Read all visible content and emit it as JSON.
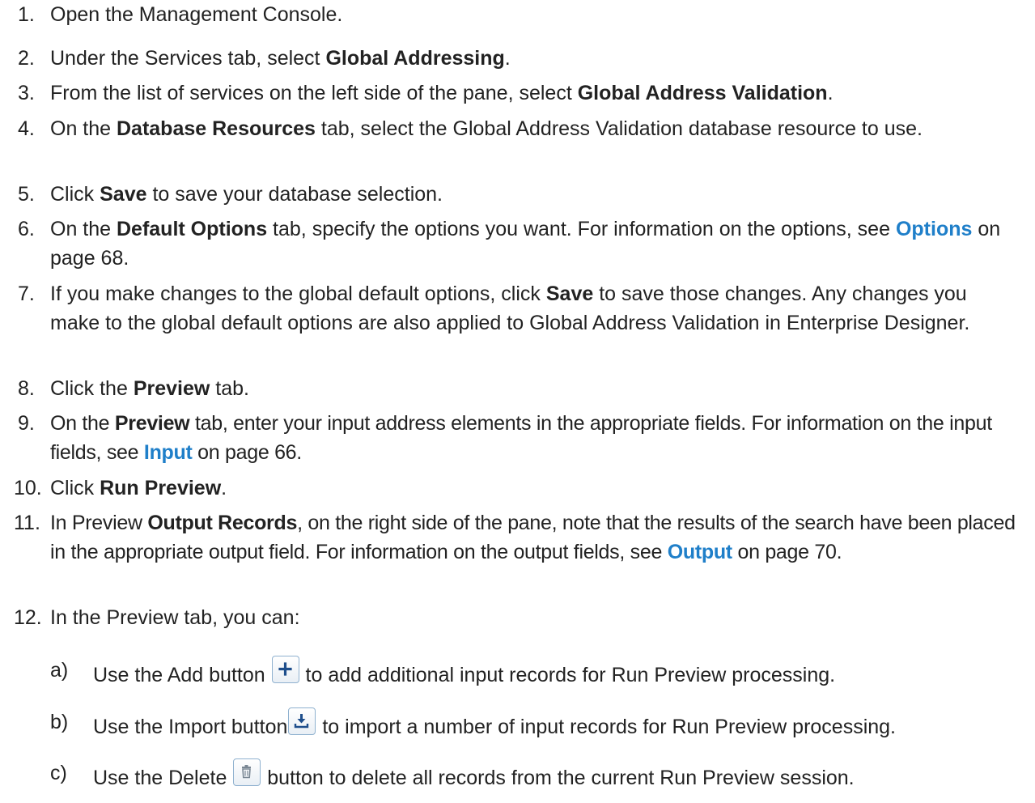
{
  "steps": [
    {
      "n": "1.",
      "parts": [
        "Open the Management Console."
      ]
    },
    {
      "n": "2.",
      "a": "Under the Services tab, select ",
      "b": "Global Addressing",
      "c": "."
    },
    {
      "n": "3.",
      "a": "From the list of services on the left side of the pane, select ",
      "b": "Global Address Validation",
      "c": "."
    },
    {
      "n": "4.",
      "a": "On the ",
      "b": "Database Resources",
      "c": " tab, select the Global Address Validation database resource to use."
    },
    {
      "n": "5.",
      "a": "Click ",
      "b": "Save",
      "c": " to save your database selection."
    },
    {
      "n": "6.",
      "a": "On the ",
      "b": "Default Options",
      "c": " tab, specify the options you want. For information on the options, see ",
      "link": "Options",
      "d": " on page 68."
    },
    {
      "n": "7.",
      "a": "If you make changes to the global default options, click ",
      "b": "Save",
      "c": " to save those changes. Any changes you make to the global default options are also applied to Global Address Validation in Enterprise Designer."
    },
    {
      "n": "8.",
      "a": "Click the ",
      "b": "Preview",
      "c": " tab."
    },
    {
      "n": "9.",
      "a": "On the ",
      "b": "Preview",
      "c": " tab, enter your input address elements in the appropriate fields. For information on the input fields, see ",
      "link": "Input",
      "d": " on page 66."
    },
    {
      "n": "10.",
      "a": "Click ",
      "b": "Run Preview",
      "c": "."
    },
    {
      "n": "11.",
      "a": "In Preview ",
      "b": "Output Records",
      "c": ", on the right side of the pane, note that the results of the search have been placed in the appropriate output field. For information on the output fields, see ",
      "link": "Output",
      "d": " on page 70."
    },
    {
      "n": "12.",
      "a": "In the Preview tab, you can:"
    }
  ],
  "substeps": [
    {
      "letter": "a)",
      "before": "Use the Add button ",
      "icon": "add-icon",
      "after": " to add additional input records for Run Preview processing."
    },
    {
      "letter": "b)",
      "before": "Use the Import button",
      "icon": "import-icon",
      "after": " to import a number of input records for Run Preview processing."
    },
    {
      "letter": "c)",
      "before": "Use the Delete ",
      "icon": "delete-icon",
      "after": " button to delete all records from the current Run Preview session."
    }
  ]
}
